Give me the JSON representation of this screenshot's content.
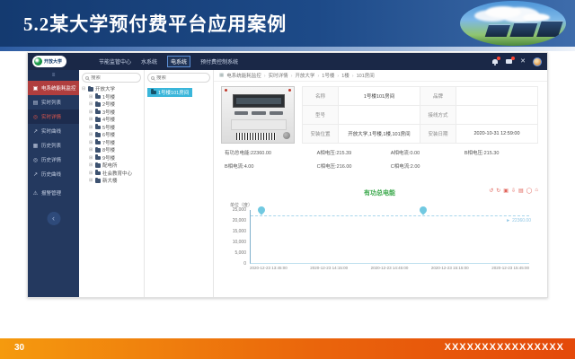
{
  "slide": {
    "title": "5.2某大学预付费平台应用案例",
    "page_number": "30",
    "footer_text": "XXXXXXXXXXXXXXXX"
  },
  "app": {
    "logo": {
      "text": "开放大学",
      "globe_icon": "green-globe-icon"
    },
    "nav": [
      {
        "label": "节能监管中心"
      },
      {
        "label": "水系统"
      },
      {
        "label": "电系统",
        "cls": "active"
      },
      {
        "label": "预付费控制系统"
      }
    ],
    "header": {
      "close_glyph": "✕",
      "icons": [
        "bell-icon",
        "message-icon",
        "fullscreen-icon",
        "avatar"
      ]
    },
    "sidebar": {
      "top_icon": "≡",
      "items": [
        {
          "icon": "▣",
          "label": "电系统能耗监控",
          "cls": "danger"
        },
        {
          "icon": "▤",
          "label": "实时列表"
        },
        {
          "icon": "◎",
          "label": "实时详情",
          "cls": "hl"
        },
        {
          "icon": "↗",
          "label": "实时曲线"
        },
        {
          "icon": "▦",
          "label": "历史列表"
        },
        {
          "icon": "◎",
          "label": "历史详情"
        },
        {
          "icon": "↗",
          "label": "历史曲线"
        },
        {
          "icon": "⚠",
          "label": "报警管理",
          "cls": "alarm"
        }
      ],
      "collapse_glyph": "‹"
    },
    "tree1": {
      "search_placeholder": "搜索",
      "root_expander": "⊟",
      "expander": "⊞",
      "root": "开放大学",
      "children": [
        "1号楼",
        "2号楼",
        "3号楼",
        "4号楼",
        "5号楼",
        "6号楼",
        "7号楼",
        "8号楼",
        "9号楼",
        "配电所",
        "社会教育中心",
        "新大楼"
      ]
    },
    "tree2": {
      "search_placeholder": "搜索",
      "selected": "1号楼101房间"
    },
    "breadcrumb_icon": "▦",
    "breadcrumb": [
      "电系统能耗监控",
      "实时详情",
      "开放大学",
      "1号楼",
      "1楼",
      "101房间"
    ],
    "device_table": [
      {
        "l1": "名称",
        "v1": "1号楼101房间",
        "l2": "品牌",
        "v2": ""
      },
      {
        "l1": "型号",
        "v1": "",
        "l2": "接线方式",
        "v2": ""
      },
      {
        "l1": "安装位置",
        "v1": "开放大学,1号楼,1楼,101房间",
        "l2": "安装日期",
        "v2": "2020-10-31 12:59:00"
      }
    ],
    "stats": [
      "有功总电能:22360.00",
      "A相电压:215.39",
      "A相电流:0.00",
      "B相电压:215.30",
      "B相电流:4.00",
      "C相电压:216.00",
      "C相电流:2.00",
      ""
    ]
  },
  "chart_data": {
    "type": "line",
    "title": "有功总电能",
    "unit_label": "单位（度）",
    "x": [
      "2020-12-23 13:45:00",
      "2020-12-23 14:15:00",
      "2020-12-23 14:45:00",
      "2020-12-23 15:15:00",
      "2020-12-23 15:45:00"
    ],
    "series": [
      {
        "name": "有功总电能",
        "values": [
          22360,
          22360,
          22360,
          22360,
          22360
        ]
      }
    ],
    "ylim": [
      0,
      25000
    ],
    "yticks": [
      "25,000",
      "20,000",
      "15,000",
      "10,000",
      "5,000",
      "0"
    ],
    "end_value_label": "22360.00",
    "end_arrow": "►",
    "grid": false,
    "legend": "none",
    "line_color": "#a9d6ec",
    "marker_color": "#58c0dc",
    "title_color": "#38a749",
    "markers": [
      {
        "left": "4%"
      },
      {
        "left": "62%"
      }
    ],
    "toolbar": [
      {
        "name": "restore-icon",
        "glyph": "↺"
      },
      {
        "name": "refresh-icon",
        "glyph": "↻"
      },
      {
        "name": "data-view-icon",
        "glyph": "▣"
      },
      {
        "name": "download-icon",
        "glyph": "⇩"
      },
      {
        "name": "table-icon",
        "glyph": "▤"
      },
      {
        "name": "zoom-icon",
        "glyph": "◯"
      },
      {
        "name": "save-image-icon",
        "glyph": "⌂"
      }
    ]
  }
}
